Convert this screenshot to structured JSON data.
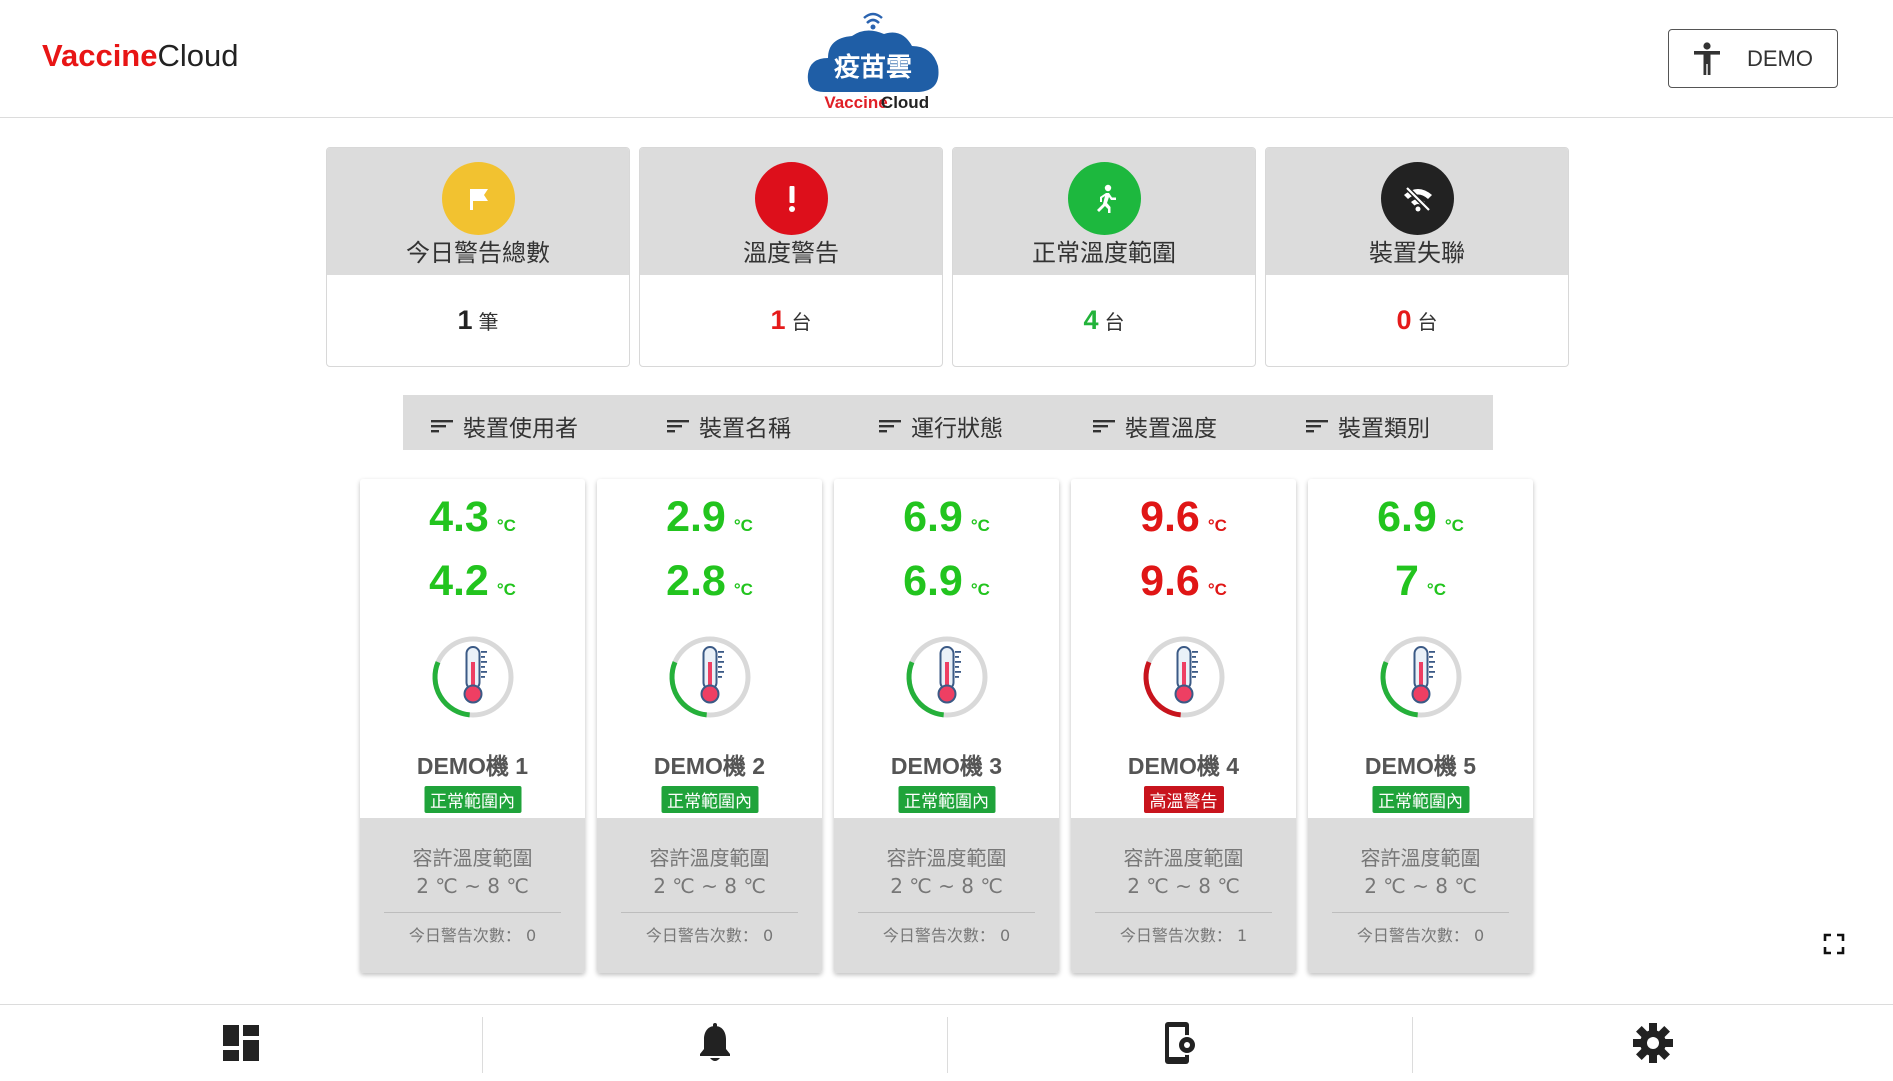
{
  "header": {
    "brand_part1": "Vaccine",
    "brand_part2": "Cloud",
    "logo_text_cn": "疫苗雲",
    "logo_text_en1": "Vaccine",
    "logo_text_en2": "Cloud",
    "user_button_label": "DEMO",
    "user_icon": "accessibility-icon"
  },
  "summary": [
    {
      "title": "今日警告總數",
      "value": "1",
      "unit": "筆",
      "icon": "flag-icon",
      "circle_color": "#f2c230",
      "value_color": "#222222"
    },
    {
      "title": "溫度警告",
      "value": "1",
      "unit": "台",
      "icon": "exclamation-icon",
      "circle_color": "#dd0f1b",
      "value_color": "#e51b1b"
    },
    {
      "title": "正常溫度範圍",
      "value": "4",
      "unit": "台",
      "icon": "running-person-icon",
      "circle_color": "#1db83e",
      "value_color": "#22b33a"
    },
    {
      "title": "裝置失聯",
      "value": "0",
      "unit": "台",
      "icon": "wifi-off-icon",
      "circle_color": "#222222",
      "value_color": "#e51b1b"
    }
  ],
  "sort": [
    {
      "label": "裝置使用者"
    },
    {
      "label": "裝置名稱"
    },
    {
      "label": "運行狀態"
    },
    {
      "label": "裝置溫度"
    },
    {
      "label": "裝置類別"
    }
  ],
  "devices": [
    {
      "temp1": "4.3",
      "temp2": "4.2",
      "unit": "°C",
      "name": "DEMO機 1",
      "status": "正常範圍內",
      "status_color": "#1fa33a",
      "temp_color": "#22c41e",
      "gauge_fraction": 0.3,
      "gauge_color": "#25b03a",
      "range_label": "容許溫度範圍",
      "range": "2 ℃ ~ 8 ℃",
      "alerts_label": "今日警告次數：",
      "alerts": "0"
    },
    {
      "temp1": "2.9",
      "temp2": "2.8",
      "unit": "°C",
      "name": "DEMO機 2",
      "status": "正常範圍內",
      "status_color": "#1fa33a",
      "temp_color": "#22c41e",
      "gauge_fraction": 0.3,
      "gauge_color": "#25b03a",
      "range_label": "容許溫度範圍",
      "range": "2 ℃ ~ 8 ℃",
      "alerts_label": "今日警告次數：",
      "alerts": "0"
    },
    {
      "temp1": "6.9",
      "temp2": "6.9",
      "unit": "°C",
      "name": "DEMO機 3",
      "status": "正常範圍內",
      "status_color": "#1fa33a",
      "temp_color": "#22c41e",
      "gauge_fraction": 0.3,
      "gauge_color": "#25b03a",
      "range_label": "容許溫度範圍",
      "range": "2 ℃ ~ 8 ℃",
      "alerts_label": "今日警告次數：",
      "alerts": "0"
    },
    {
      "temp1": "9.6",
      "temp2": "9.6",
      "unit": "°C",
      "name": "DEMO機 4",
      "status": "高溫警告",
      "status_color": "#c8141d",
      "temp_color": "#e01616",
      "gauge_fraction": 0.3,
      "gauge_color": "#c8141d",
      "range_label": "容許溫度範圍",
      "range": "2 ℃ ~ 8 ℃",
      "alerts_label": "今日警告次數：",
      "alerts": "1"
    },
    {
      "temp1": "6.9",
      "temp2": "7",
      "unit": "°C",
      "name": "DEMO機 5",
      "status": "正常範圍內",
      "status_color": "#1fa33a",
      "temp_color": "#22c41e",
      "gauge_fraction": 0.3,
      "gauge_color": "#25b03a",
      "range_label": "容許溫度範圍",
      "range": "2 ℃ ~ 8 ℃",
      "alerts_label": "今日警告次數：",
      "alerts": "0"
    }
  ],
  "bottom_nav": [
    {
      "icon": "dashboard-icon"
    },
    {
      "icon": "bell-icon"
    },
    {
      "icon": "device-settings-icon"
    },
    {
      "icon": "gear-icon"
    }
  ],
  "fullscreen_icon": "fullscreen-icon"
}
